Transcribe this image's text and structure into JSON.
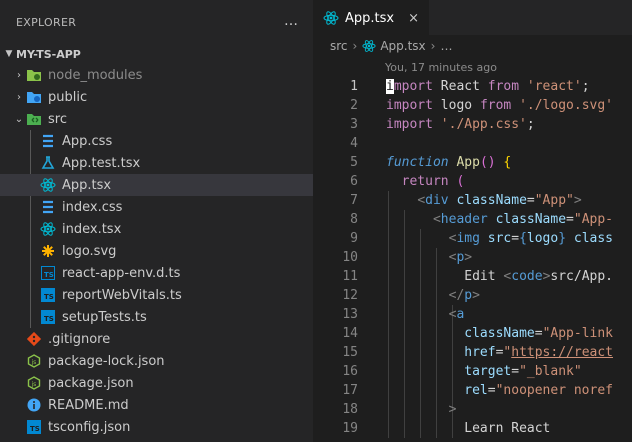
{
  "explorer": {
    "title": "EXPLORER",
    "more_icon": "…",
    "project": "MY-TS-APP",
    "items": [
      {
        "label": "node_modules",
        "icon": "folder-node-icon",
        "color": "#8bc34a",
        "dim": true
      },
      {
        "label": "public",
        "icon": "folder-public-icon",
        "color": "#42a5f5"
      },
      {
        "label": "src",
        "icon": "folder-src-icon",
        "color": "#4caf50"
      },
      {
        "label": "App.css",
        "icon": "css-file-icon",
        "color": "#42a5f5"
      },
      {
        "label": "App.test.tsx",
        "icon": "test-file-icon",
        "color": "#22a6d8"
      },
      {
        "label": "App.tsx",
        "icon": "react-file-icon",
        "color": "#00bcd4"
      },
      {
        "label": "index.css",
        "icon": "css-file-icon",
        "color": "#42a5f5"
      },
      {
        "label": "index.tsx",
        "icon": "react-file-icon",
        "color": "#00bcd4"
      },
      {
        "label": "logo.svg",
        "icon": "svg-file-icon",
        "color": "#ffb300"
      },
      {
        "label": "react-app-env.d.ts",
        "icon": "ts-file-icon",
        "color": "#0288d1"
      },
      {
        "label": "reportWebVitals.ts",
        "icon": "ts-file-icon",
        "color": "#0288d1"
      },
      {
        "label": "setupTests.ts",
        "icon": "ts-file-icon",
        "color": "#0288d1"
      },
      {
        "label": ".gitignore",
        "icon": "git-file-icon",
        "color": "#e64a19"
      },
      {
        "label": "package-lock.json",
        "icon": "nodejs-file-icon",
        "color": "#8bc34a"
      },
      {
        "label": "package.json",
        "icon": "nodejs-file-icon",
        "color": "#8bc34a"
      },
      {
        "label": "README.md",
        "icon": "info-file-icon",
        "color": "#42a5f5"
      },
      {
        "label": "tsconfig.json",
        "icon": "tsconfig-file-icon",
        "color": "#0288d1"
      }
    ]
  },
  "editor": {
    "tab_label": "App.tsx",
    "tab_close": "×",
    "breadcrumb": [
      "src",
      "App.tsx",
      "…"
    ],
    "blame": "You, 17 minutes ago",
    "line_numbers": [
      "1",
      "2",
      "3",
      "4",
      "5",
      "6",
      "7",
      "8",
      "9",
      "10",
      "11",
      "12",
      "13",
      "14",
      "15",
      "16",
      "17",
      "18",
      "19"
    ],
    "code": {
      "l1_import": "import",
      "l1_react": " React ",
      "l1_from": "from",
      "l1_str": " 'react'",
      "l1_semi": ";",
      "l2_import": "import",
      "l2_logo": " logo ",
      "l2_from": "from",
      "l2_str": " './logo.svg'",
      "l3_import": "import",
      "l3_str": " './App.css'",
      "l3_semi": ";",
      "l5_function": "function",
      "l5_name": " App",
      "l5_paren": "()",
      "l5_brace": " {",
      "l6_return": "return",
      "l6_paren": " (",
      "l7_open": "<",
      "l7_tag": "div",
      "l7_attr": " className",
      "l7_eq": "=",
      "l7_str": "\"App\"",
      "l7_close": ">",
      "l8_open": "<",
      "l8_tag": "header",
      "l8_attr": " className",
      "l8_eq": "=",
      "l8_str": "\"App-",
      "l9_open": "<",
      "l9_tag": "img",
      "l9_attr": " src",
      "l9_eq": "=",
      "l9_brace_open": "{",
      "l9_val": "logo",
      "l9_brace_close": "}",
      "l9_attr2": " class",
      "l10_open": "<",
      "l10_tag": "p",
      "l10_close": ">",
      "l11_text": "Edit ",
      "l11_open": "<",
      "l11_tag": "code",
      "l11_close": ">",
      "l11_text2": "src/App.",
      "l12_open": "</",
      "l12_tag": "p",
      "l12_close": ">",
      "l13_open": "<",
      "l13_tag": "a",
      "l14_attr": "className",
      "l14_eq": "=",
      "l14_str": "\"App-link",
      "l15_attr": "href",
      "l15_eq": "=",
      "l15_q": "\"",
      "l15_url": "https://react",
      "l16_attr": "target",
      "l16_eq": "=",
      "l16_str": "\"_blank\"",
      "l17_attr": "rel",
      "l17_eq": "=",
      "l17_str": "\"noopener noref",
      "l18_close": ">",
      "l19_text": "Learn React"
    }
  }
}
